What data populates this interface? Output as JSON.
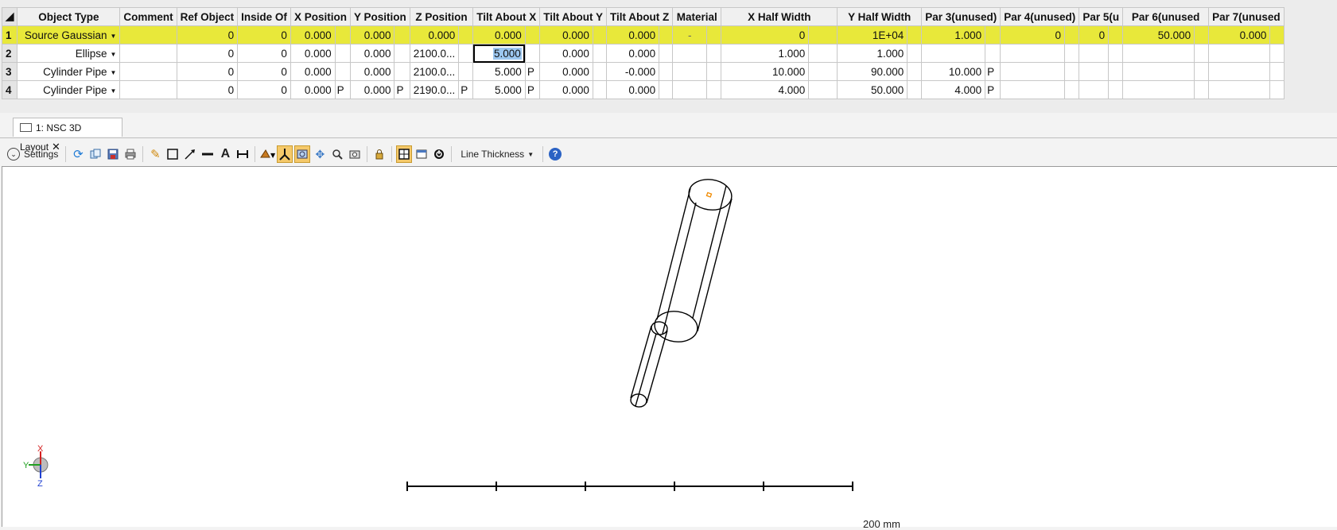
{
  "editor": {
    "columns": [
      "Object Type",
      "Comment",
      "Ref Object",
      "Inside Of",
      "X Position",
      "Y Position",
      "Z Position",
      "Tilt About X",
      "Tilt About Y",
      "Tilt About Z",
      "Material",
      "X Half Width",
      "Y Half Width",
      "Par 3(unused)",
      "Par 4(unused)",
      "Par 5(u",
      "Par 6(unused",
      "Par 7(unused"
    ],
    "rows": [
      {
        "num": "1",
        "type": "Source Gaussian",
        "comment": "",
        "ref": "0",
        "inside": "0",
        "x": "0.000",
        "xs": "",
        "y": "0.000",
        "ys": "",
        "z": "0.000",
        "zs": "",
        "tx": "0.000",
        "txs": "",
        "ty": "0.000",
        "tz": "0.000",
        "mat": "-",
        "xhw": "0",
        "yhw": "1E+04",
        "p3": "1.000",
        "p3s": "",
        "p4": "0",
        "p5": "0",
        "p6": "50.000",
        "p7": "0.000"
      },
      {
        "num": "2",
        "type": "Ellipse",
        "comment": "",
        "ref": "0",
        "inside": "0",
        "x": "0.000",
        "xs": "",
        "y": "0.000",
        "ys": "",
        "z": "2100.0...",
        "zs": "",
        "tx": "5.000",
        "txs": "",
        "ty": "0.000",
        "tz": "0.000",
        "mat": "",
        "xhw": "1.000",
        "yhw": "1.000",
        "p3": "",
        "p3s": "",
        "p4": "",
        "p5": "",
        "p6": "",
        "p7": ""
      },
      {
        "num": "3",
        "type": "Cylinder Pipe",
        "comment": "",
        "ref": "0",
        "inside": "0",
        "x": "0.000",
        "xs": "",
        "y": "0.000",
        "ys": "",
        "z": "2100.0...",
        "zs": "",
        "tx": "5.000",
        "txs": "P",
        "ty": "0.000",
        "tz": "-0.000",
        "mat": "",
        "xhw": "10.000",
        "yhw": "90.000",
        "p3": "10.000",
        "p3s": "P",
        "p4": "",
        "p5": "",
        "p6": "",
        "p7": ""
      },
      {
        "num": "4",
        "type": "Cylinder Pipe",
        "comment": "",
        "ref": "0",
        "inside": "0",
        "x": "0.000",
        "xs": "P",
        "y": "0.000",
        "ys": "P",
        "z": "2190.0...",
        "zs": "P",
        "tx": "5.000",
        "txs": "P",
        "ty": "0.000",
        "tz": "0.000",
        "mat": "",
        "xhw": "4.000",
        "yhw": "50.000",
        "p3": "4.000",
        "p3s": "P",
        "p4": "",
        "p5": "",
        "p6": "",
        "p7": ""
      }
    ]
  },
  "tab": {
    "label": "1: NSC 3D Layout"
  },
  "toolbar": {
    "settings_label": "Settings",
    "line_thickness_label": "Line Thickness",
    "help_glyph": "?"
  },
  "layout_view": {
    "scale_label": "200 mm",
    "axis_labels": {
      "x": "X",
      "y": "Y",
      "z": "Z"
    },
    "colors": {
      "wire": "#000000",
      "source": "#f08a00",
      "axis_x": "#d42020",
      "axis_y": "#20a020",
      "axis_z": "#2040d0"
    }
  },
  "colors": {
    "highlight_row": "#e8e83a",
    "selected_cell": "#9cc7f0",
    "active_tool": "#f5c96a"
  }
}
